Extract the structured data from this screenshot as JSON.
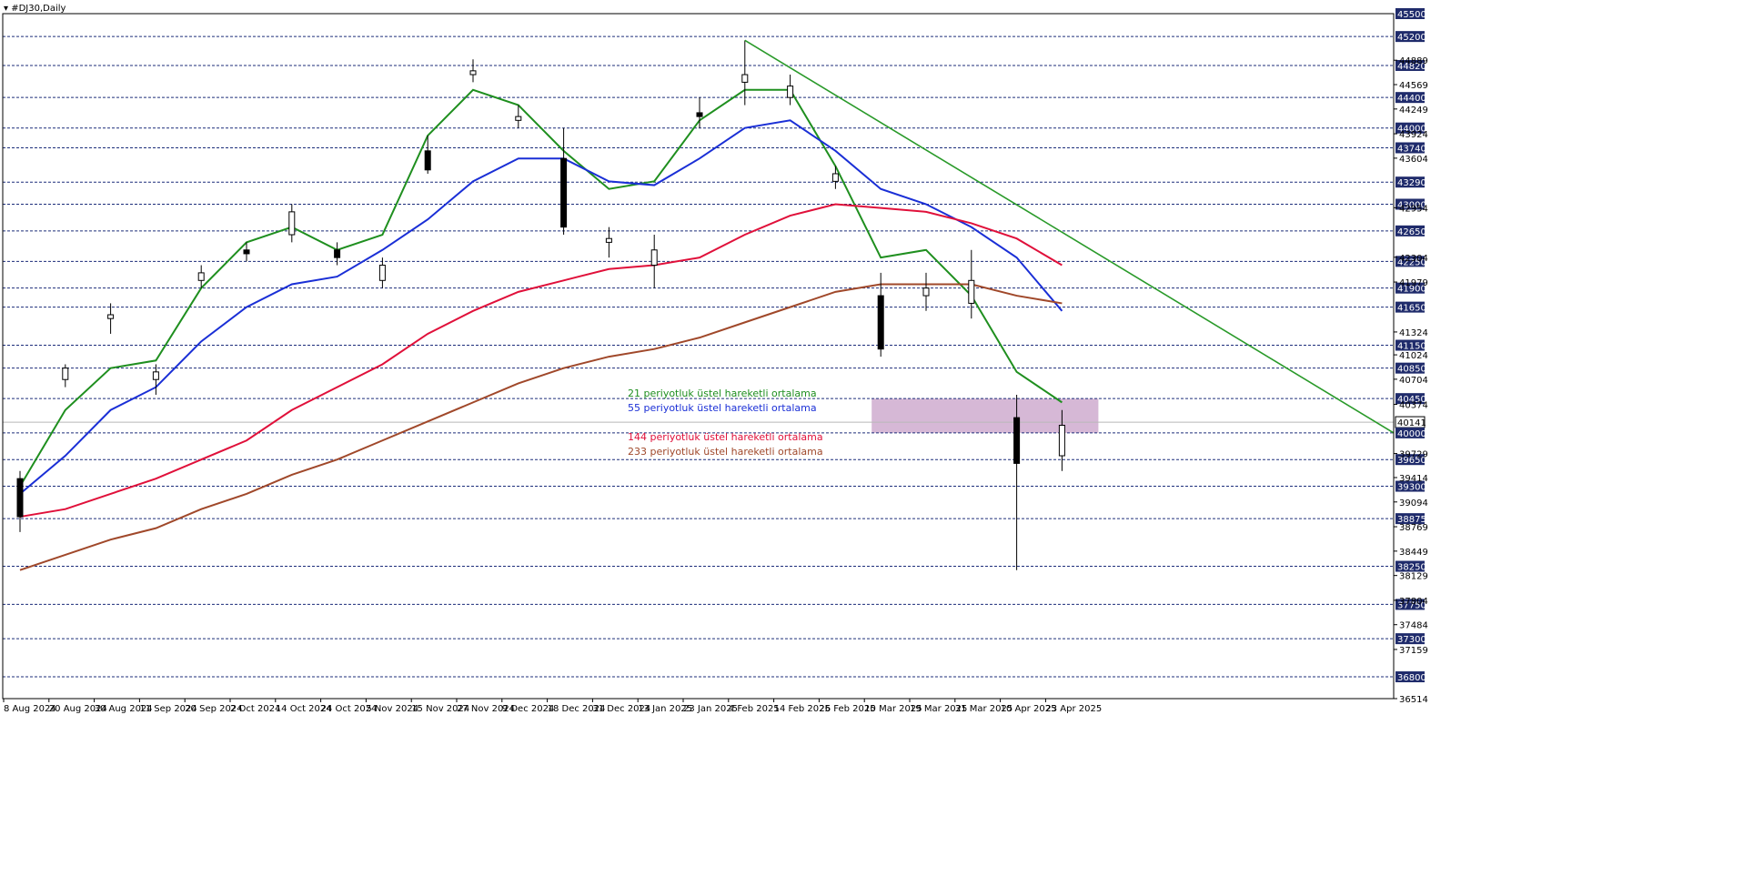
{
  "symbol": "#DJ30,Daily",
  "colors": {
    "ema21": "#1f8f1f",
    "ema55": "#1a2fd6",
    "ema144": "#e0103a",
    "ema233": "#a0482a",
    "trendline": "#2a9a2a",
    "zone": "#c8a0c8",
    "grid_level": "#1c2d7a",
    "label_bg": "#1f2b6b",
    "candle": "#000000"
  },
  "legend": [
    {
      "key": "ema21",
      "text": "21 periyotluk üstel hareketli ortalama"
    },
    {
      "key": "ema55",
      "text": "55 periyotluk üstel hareketli ortalama"
    },
    {
      "key": "ema144",
      "text": "144 periyotluk üstel hareketli ortalama"
    },
    {
      "key": "ema233",
      "text": "233 periyotluk üstel hareketli ortalama"
    }
  ],
  "chart_data": {
    "type": "candlestick",
    "ylim": [
      36514,
      45500
    ],
    "y_levels_highlighted": [
      45500,
      45200,
      44820,
      44400,
      44000,
      43740,
      43290,
      43000,
      42650,
      42250,
      41900,
      41650,
      41150,
      40850,
      40450,
      40141,
      40000,
      39650,
      39300,
      38875,
      38250,
      37750,
      37300,
      36800
    ],
    "y_ticks_plain": [
      44889,
      44569,
      44249,
      43924,
      43604,
      42954,
      42304,
      41979,
      41324,
      41024,
      40704,
      40374,
      39729,
      39414,
      39094,
      38769,
      38449,
      38129,
      37804,
      37484,
      37159,
      36514
    ],
    "x_labels": [
      "8 Aug 2024",
      "20 Aug 2024",
      "30 Aug 2024",
      "11 Sep 2024",
      "20 Sep 2024",
      "2 Oct 2024",
      "14 Oct 2024",
      "24 Oct 2024",
      "5 Nov 2024",
      "15 Nov 2024",
      "27 Nov 2024",
      "9 Dec 2024",
      "18 Dec 2024",
      "31 Dec 2024",
      "13 Jan 2025",
      "23 Jan 2025",
      "4 Feb 2025",
      "14 Feb 2025",
      "26 Feb 2025",
      "10 Mar 2025",
      "19 Mar 2025",
      "31 Mar 2025",
      "10 Apr 2025",
      "23 Apr 2025"
    ],
    "current_price": 40141,
    "resistance_zone": [
      40000,
      40450
    ],
    "trendline": {
      "from": [
        "4 Feb 2025",
        45150
      ],
      "to": [
        "30 May 2025",
        40000
      ]
    },
    "ohlc": [
      [
        "8 Aug 2024",
        39400,
        39500,
        38700,
        38900
      ],
      [
        "20 Aug 2024",
        40700,
        40900,
        40600,
        40850
      ],
      [
        "30 Aug 2024",
        41500,
        41700,
        41300,
        41550
      ],
      [
        "11 Sep 2024",
        40700,
        40900,
        40500,
        40800
      ],
      [
        "20 Sep 2024",
        42000,
        42200,
        41900,
        42100
      ],
      [
        "2 Oct 2024",
        42400,
        42500,
        42250,
        42350
      ],
      [
        "14 Oct 2024",
        42600,
        43000,
        42500,
        42900
      ],
      [
        "24 Oct 2024",
        42400,
        42500,
        42200,
        42300
      ],
      [
        "5 Nov 2024",
        42000,
        42300,
        41900,
        42200
      ],
      [
        "15 Nov 2024",
        43700,
        43900,
        43400,
        43450
      ],
      [
        "27 Nov 2024",
        44700,
        44900,
        44600,
        44750
      ],
      [
        "9 Dec 2024",
        44100,
        44300,
        44000,
        44150
      ],
      [
        "18 Dec 2024",
        43600,
        44000,
        42600,
        42700
      ],
      [
        "31 Dec 2024",
        42500,
        42700,
        42300,
        42550
      ],
      [
        "13 Jan 2025",
        42200,
        42600,
        41900,
        42400
      ],
      [
        "23 Jan 2025",
        44200,
        44400,
        44000,
        44150
      ],
      [
        "4 Feb 2025",
        44600,
        45150,
        44300,
        44700
      ],
      [
        "14 Feb 2025",
        44400,
        44700,
        44300,
        44550
      ],
      [
        "26 Feb 2025",
        43300,
        43500,
        43200,
        43400
      ],
      [
        "10 Mar 2025",
        41800,
        42100,
        41000,
        41100
      ],
      [
        "19 Mar 2025",
        41800,
        42100,
        41600,
        41900
      ],
      [
        "31 Mar 2025",
        41700,
        42400,
        41500,
        42000
      ],
      [
        "10 Apr 2025",
        40200,
        40500,
        38200,
        39600
      ],
      [
        "23 Apr 2025",
        39700,
        40300,
        39500,
        40100
      ]
    ],
    "series": [
      {
        "name": "21 periyotluk üstel hareketli ortalama",
        "key": "ema21",
        "values": [
          39300,
          40300,
          40850,
          40950,
          41900,
          42500,
          42700,
          42400,
          42600,
          43900,
          44500,
          44300,
          43700,
          43200,
          43300,
          44100,
          44500,
          44500,
          43500,
          42300,
          42400,
          41800,
          40800,
          40400
        ]
      },
      {
        "name": "55 periyotluk üstel hareketli ortalama",
        "key": "ema55",
        "values": [
          39200,
          39700,
          40300,
          40600,
          41200,
          41650,
          41950,
          42050,
          42400,
          42800,
          43300,
          43600,
          43600,
          43300,
          43250,
          43600,
          44000,
          44100,
          43700,
          43200,
          43000,
          42700,
          42300,
          41600
        ]
      },
      {
        "name": "144 periyotluk üstel hareketli ortalama",
        "key": "ema144",
        "values": [
          38900,
          39000,
          39200,
          39400,
          39650,
          39900,
          40300,
          40600,
          40900,
          41300,
          41600,
          41850,
          42000,
          42150,
          42200,
          42300,
          42600,
          42850,
          43000,
          42950,
          42900,
          42750,
          42550,
          42200
        ]
      },
      {
        "name": "233 periyotluk üstel hareketli ortalama",
        "key": "ema233",
        "values": [
          38200,
          38400,
          38600,
          38750,
          39000,
          39200,
          39450,
          39650,
          39900,
          40150,
          40400,
          40650,
          40850,
          41000,
          41100,
          41250,
          41450,
          41650,
          41850,
          41950,
          41950,
          41950,
          41800,
          41700
        ]
      }
    ]
  }
}
